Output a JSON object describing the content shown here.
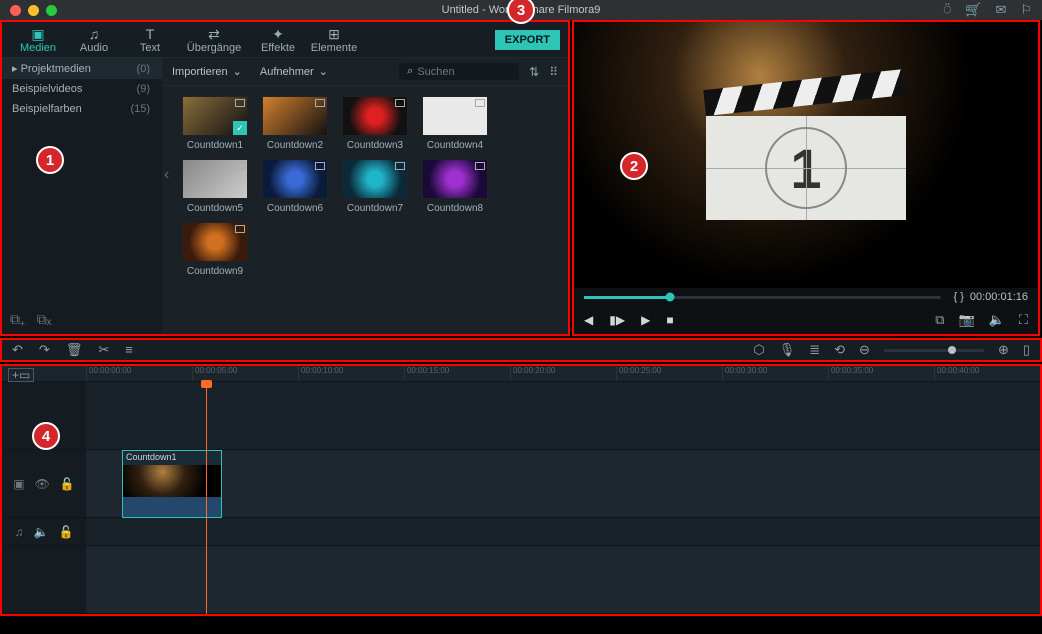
{
  "window": {
    "title": "Untitled - Wondershare Filmora9"
  },
  "topright_icons": [
    "user",
    "cart",
    "mail",
    "bell"
  ],
  "tabs": [
    {
      "label": "Medien",
      "active": true,
      "icon": "folder"
    },
    {
      "label": "Audio",
      "active": false,
      "icon": "note"
    },
    {
      "label": "Text",
      "active": false,
      "icon": "T"
    },
    {
      "label": "Übergänge",
      "active": false,
      "icon": "swap"
    },
    {
      "label": "Effekte",
      "active": false,
      "icon": "fx"
    },
    {
      "label": "Elemente",
      "active": false,
      "icon": "grid"
    }
  ],
  "export_label": "EXPORT",
  "sidebar": {
    "items": [
      {
        "label": "Projektmedien",
        "count": "(0)",
        "selected": true
      },
      {
        "label": "Beispielvideos",
        "count": "(9)",
        "selected": false
      },
      {
        "label": "Beispielfarben",
        "count": "(15)",
        "selected": false
      }
    ]
  },
  "media_toolbar": {
    "import_label": "Importieren",
    "record_label": "Aufnehmer",
    "search_placeholder": "Suchen"
  },
  "clips": [
    {
      "label": "Countdown1",
      "klass": "th-a",
      "selected": true
    },
    {
      "label": "Countdown2",
      "klass": "th-b"
    },
    {
      "label": "Countdown3",
      "klass": "th-c"
    },
    {
      "label": "Countdown4",
      "klass": "th-d"
    },
    {
      "label": "Countdown5",
      "klass": "th-e"
    },
    {
      "label": "Countdown6",
      "klass": "th-f"
    },
    {
      "label": "Countdown7",
      "klass": "th-g"
    },
    {
      "label": "Countdown8",
      "klass": "th-h"
    },
    {
      "label": "Countdown9",
      "klass": "th-i"
    }
  ],
  "preview": {
    "number": "1",
    "timecode": "00:00:01:16",
    "brace": "{  }"
  },
  "timeline": {
    "ticks": [
      "00:00:00:00",
      "00:00:05:00",
      "00:00:10:00",
      "00:00:15:00",
      "00:00:20:00",
      "00:00:25:00",
      "00:00:30:00",
      "00:00:35:00",
      "00:00:40:00"
    ],
    "clip_label": "Countdown1"
  },
  "markers": {
    "one": "1",
    "two": "2",
    "three": "3",
    "four": "4"
  }
}
